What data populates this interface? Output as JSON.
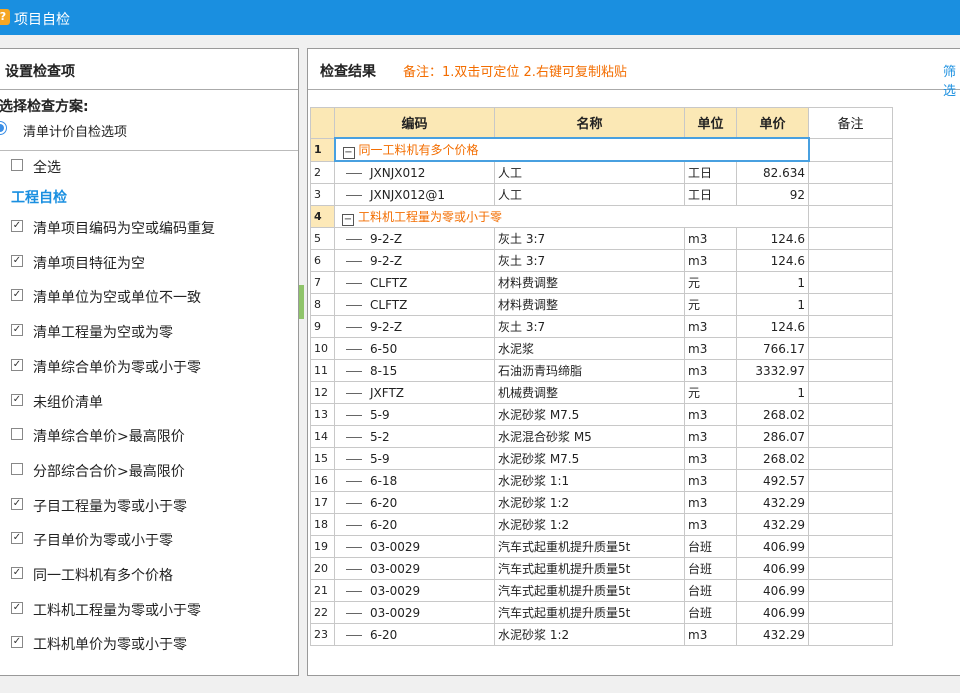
{
  "window": {
    "title": "项目自检",
    "icon_glyph": "?"
  },
  "left": {
    "header": "设置检查项",
    "scheme_label": "选择检查方案:",
    "scheme_option": "清单计价自检选项",
    "select_all": "全选",
    "section": "工程自检",
    "items": [
      {
        "label": "清单项目编码为空或编码重复",
        "checked": true
      },
      {
        "label": "清单项目特征为空",
        "checked": true
      },
      {
        "label": "清单单位为空或单位不一致",
        "checked": true
      },
      {
        "label": "清单工程量为空或为零",
        "checked": true
      },
      {
        "label": "清单综合单价为零或小于零",
        "checked": true
      },
      {
        "label": "未组价清单",
        "checked": true
      },
      {
        "label": "清单综合单价>最高限价",
        "checked": false
      },
      {
        "label": "分部综合合价>最高限价",
        "checked": false
      },
      {
        "label": "子目工程量为零或小于零",
        "checked": true
      },
      {
        "label": "子目单价为零或小于零",
        "checked": true
      },
      {
        "label": "同一工料机有多个价格",
        "checked": true
      },
      {
        "label": "工料机工程量为零或小于零",
        "checked": true
      },
      {
        "label": "工料机单价为零或小于零",
        "checked": true
      }
    ]
  },
  "right": {
    "title": "检查结果",
    "remark": "备注：1.双击可定位 2.右键可复制粘贴",
    "filter": "筛选",
    "columns": [
      "编码",
      "名称",
      "单位",
      "单价",
      "备注"
    ],
    "rows": [
      {
        "n": "1",
        "group": true,
        "label": "同一工料机有多个价格",
        "selected": true
      },
      {
        "n": "2",
        "code": "JXNJX012",
        "name": "人工",
        "unit": "工日",
        "price": "82.634"
      },
      {
        "n": "3",
        "code": "JXNJX012@1",
        "name": "人工",
        "unit": "工日",
        "price": "92"
      },
      {
        "n": "4",
        "group": true,
        "label": "工料机工程量为零或小于零"
      },
      {
        "n": "5",
        "code": "9-2-Z",
        "name": "灰土 3:7",
        "unit": "m3",
        "price": "124.6"
      },
      {
        "n": "6",
        "code": "9-2-Z",
        "name": "灰土 3:7",
        "unit": "m3",
        "price": "124.6"
      },
      {
        "n": "7",
        "code": "CLFTZ",
        "name": "材料费调整",
        "unit": "元",
        "price": "1"
      },
      {
        "n": "8",
        "code": "CLFTZ",
        "name": "材料费调整",
        "unit": "元",
        "price": "1"
      },
      {
        "n": "9",
        "code": "9-2-Z",
        "name": "灰土 3:7",
        "unit": "m3",
        "price": "124.6"
      },
      {
        "n": "10",
        "code": "6-50",
        "name": "水泥浆",
        "unit": "m3",
        "price": "766.17"
      },
      {
        "n": "11",
        "code": "8-15",
        "name": "石油沥青玛缔脂",
        "unit": "m3",
        "price": "3332.97"
      },
      {
        "n": "12",
        "code": "JXFTZ",
        "name": "机械费调整",
        "unit": "元",
        "price": "1"
      },
      {
        "n": "13",
        "code": "5-9",
        "name": "水泥砂浆 M7.5",
        "unit": "m3",
        "price": "268.02"
      },
      {
        "n": "14",
        "code": "5-2",
        "name": "水泥混合砂浆 M5",
        "unit": "m3",
        "price": "286.07"
      },
      {
        "n": "15",
        "code": "5-9",
        "name": "水泥砂浆 M7.5",
        "unit": "m3",
        "price": "268.02"
      },
      {
        "n": "16",
        "code": "6-18",
        "name": "水泥砂浆 1:1",
        "unit": "m3",
        "price": "492.57"
      },
      {
        "n": "17",
        "code": "6-20",
        "name": "水泥砂浆 1:2",
        "unit": "m3",
        "price": "432.29"
      },
      {
        "n": "18",
        "code": "6-20",
        "name": "水泥砂浆 1:2",
        "unit": "m3",
        "price": "432.29"
      },
      {
        "n": "19",
        "code": "03-0029",
        "name": "汽车式起重机提升质量5t",
        "unit": "台班",
        "price": "406.99"
      },
      {
        "n": "20",
        "code": "03-0029",
        "name": "汽车式起重机提升质量5t",
        "unit": "台班",
        "price": "406.99"
      },
      {
        "n": "21",
        "code": "03-0029",
        "name": "汽车式起重机提升质量5t",
        "unit": "台班",
        "price": "406.99"
      },
      {
        "n": "22",
        "code": "03-0029",
        "name": "汽车式起重机提升质量5t",
        "unit": "台班",
        "price": "406.99"
      },
      {
        "n": "23",
        "code": "6-20",
        "name": "水泥砂浆 1:2",
        "unit": "m3",
        "price": "432.29"
      }
    ]
  }
}
